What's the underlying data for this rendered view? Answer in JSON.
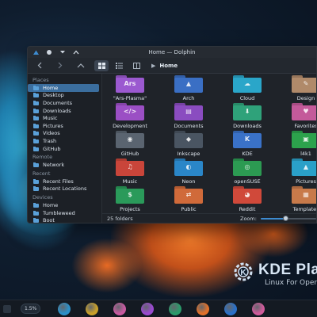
{
  "window": {
    "title": "Home — Dolphin"
  },
  "breadcrumb": {
    "current": "Home"
  },
  "sidebar": {
    "sections": [
      {
        "heading": "Places",
        "items": [
          {
            "label": "Home",
            "icon": "home-icon",
            "selected": true
          },
          {
            "label": "Desktop",
            "icon": "desktop-icon"
          },
          {
            "label": "Documents",
            "icon": "documents-icon"
          },
          {
            "label": "Downloads",
            "icon": "downloads-icon"
          },
          {
            "label": "Music",
            "icon": "music-icon"
          },
          {
            "label": "Pictures",
            "icon": "pictures-icon"
          },
          {
            "label": "Videos",
            "icon": "videos-icon"
          },
          {
            "label": "Trash",
            "icon": "trash-icon"
          },
          {
            "label": "GitHub",
            "icon": "github-icon"
          }
        ]
      },
      {
        "heading": "Remote",
        "items": [
          {
            "label": "Network",
            "icon": "network-icon"
          }
        ]
      },
      {
        "heading": "Recent",
        "items": [
          {
            "label": "Recent Files",
            "icon": "recent-files-icon"
          },
          {
            "label": "Recent Locations",
            "icon": "recent-locations-icon"
          }
        ]
      },
      {
        "heading": "Devices",
        "items": [
          {
            "label": "Home",
            "icon": "drive-icon"
          },
          {
            "label": "Tumbleweed",
            "icon": "drive-icon"
          },
          {
            "label": "Boot",
            "icon": "drive-icon"
          }
        ]
      }
    ]
  },
  "folders": [
    {
      "label": "\"Ars-Plasma\"",
      "color": "#9b59d0",
      "glyph": "Ars",
      "icon": "folder-ars-icon"
    },
    {
      "label": "Arch",
      "color": "#3a6fc4",
      "glyph": "▲",
      "icon": "arch-icon"
    },
    {
      "label": "Cloud",
      "color": "#2aa6c9",
      "glyph": "☁",
      "icon": "cloud-icon"
    },
    {
      "label": "Design",
      "color": "#b08a6a",
      "glyph": "✎",
      "icon": "design-icon"
    },
    {
      "label": "Development",
      "color": "#9b4fc4",
      "glyph": "</>",
      "icon": "code-icon"
    },
    {
      "label": "Documents",
      "color": "#8a4cc0",
      "glyph": "▤",
      "icon": "documents-icon"
    },
    {
      "label": "Downloads",
      "color": "#2fa27a",
      "glyph": "⬇",
      "icon": "downloads-icon"
    },
    {
      "label": "Favorites",
      "color": "#c45a9a",
      "glyph": "♥",
      "icon": "favorites-icon"
    },
    {
      "label": "GitHub",
      "color": "#5a6470",
      "glyph": "◉",
      "icon": "github-icon"
    },
    {
      "label": "Inkscape",
      "color": "#4a5562",
      "glyph": "◆",
      "icon": "inkscape-icon"
    },
    {
      "label": "KDE",
      "color": "#3a72c8",
      "glyph": "K",
      "icon": "kde-icon"
    },
    {
      "label": "l4k1",
      "color": "#2ca24c",
      "glyph": "▣",
      "icon": "l4k1-icon"
    },
    {
      "label": "Music",
      "color": "#c9453a",
      "glyph": "♫",
      "icon": "music-icon"
    },
    {
      "label": "Neon",
      "color": "#2a86c8",
      "glyph": "◐",
      "icon": "neon-icon"
    },
    {
      "label": "openSUSE",
      "color": "#2c9a52",
      "glyph": "◎",
      "icon": "opensuse-icon"
    },
    {
      "label": "Pictures",
      "color": "#2aa0c8",
      "glyph": "▲",
      "icon": "pictures-icon"
    },
    {
      "label": "Projects",
      "color": "#2a9a5a",
      "glyph": "$",
      "icon": "projects-icon"
    },
    {
      "label": "Public",
      "color": "#d06a3a",
      "glyph": "⇄",
      "icon": "public-icon"
    },
    {
      "label": "Reddit",
      "color": "#d0493a",
      "glyph": "◕",
      "icon": "reddit-icon"
    },
    {
      "label": "Templates",
      "color": "#c87a4a",
      "glyph": "▦",
      "icon": "templates-icon"
    }
  ],
  "statusbar": {
    "count": "25 folders",
    "zoom_label": "Zoom:",
    "zoom_level": 0.45
  },
  "branding": {
    "title": "KDE Pla",
    "tagline": "Linux For Oper"
  },
  "taskbar": {
    "pill": "1.5%",
    "apps": [
      {
        "icon": "app-blue-icon",
        "color": "#2b90c8"
      },
      {
        "icon": "app-yellow-icon",
        "color": "#c8a02a"
      },
      {
        "icon": "app-multicolor-icon",
        "color": "#c85aa0"
      },
      {
        "icon": "app-purple-icon",
        "color": "#9a4ad0"
      },
      {
        "icon": "app-green-icon",
        "color": "#2a9a6a"
      },
      {
        "icon": "app-firefox-icon",
        "color": "#e0702a"
      },
      {
        "icon": "app-dolphin-icon",
        "color": "#2a70c8"
      },
      {
        "icon": "app-pink-icon",
        "color": "#d05a9a"
      }
    ]
  }
}
